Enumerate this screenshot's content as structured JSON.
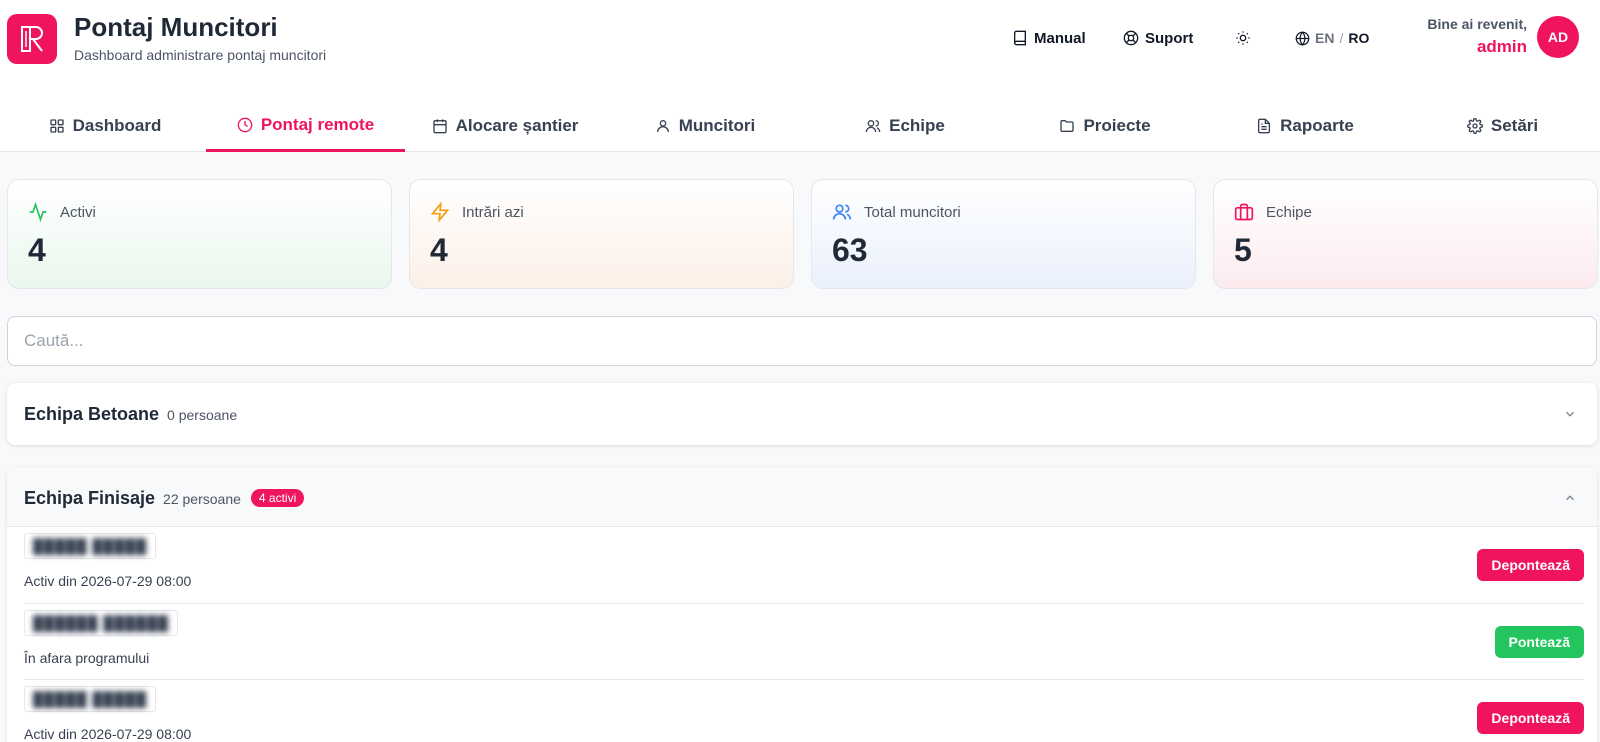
{
  "header": {
    "title": "Pontaj Muncitori",
    "subtitle": "Dashboard administrare pontaj muncitori",
    "manual_label": "Manual",
    "support_label": "Suport",
    "lang_en": "EN",
    "lang_sep": "/",
    "lang_ro": "RO",
    "welcome_text": "Bine ai revenit,",
    "username": "admin",
    "avatar_initials": "AD"
  },
  "tabs": [
    {
      "label": "Dashboard",
      "icon": "grid-icon",
      "active": false
    },
    {
      "label": "Pontaj remote",
      "icon": "clock-icon",
      "active": true
    },
    {
      "label": "Alocare șantier",
      "icon": "calendar-icon",
      "active": false
    },
    {
      "label": "Muncitori",
      "icon": "user-icon",
      "active": false
    },
    {
      "label": "Echipe",
      "icon": "users-icon",
      "active": false
    },
    {
      "label": "Proiecte",
      "icon": "folder-icon",
      "active": false
    },
    {
      "label": "Rapoarte",
      "icon": "file-text-icon",
      "active": false
    },
    {
      "label": "Setări",
      "icon": "gear-icon",
      "active": false
    }
  ],
  "stats": [
    {
      "label": "Activi",
      "value": "4",
      "icon": "activity-icon",
      "color": "#22c55e"
    },
    {
      "label": "Intrări azi",
      "value": "4",
      "icon": "lightning-icon",
      "color": "#f59e0b"
    },
    {
      "label": "Total muncitori",
      "value": "63",
      "icon": "users-icon",
      "color": "#3b82f6"
    },
    {
      "label": "Echipe",
      "value": "5",
      "icon": "briefcase-icon",
      "color": "#f0135f"
    }
  ],
  "search": {
    "placeholder": "Caută..."
  },
  "groups": [
    {
      "name": "Echipa Betoane",
      "count": "0 persoane",
      "expanded": false
    },
    {
      "name": "Echipa Finisaje",
      "count": "22 persoane",
      "badge": "4 activi",
      "expanded": true,
      "workers": [
        {
          "name": "█████ █████",
          "status": "Activ din 2026-07-29 08:00",
          "action": "Depontează"
        },
        {
          "name": "██████ ██████",
          "status": "În afara programului",
          "action": "Pontează"
        },
        {
          "name": "█████ █████",
          "status": "Activ din 2026-07-29 08:00",
          "action": "Depontează"
        }
      ]
    }
  ],
  "colors": {
    "accent": "#f0135f",
    "success": "#22c55e"
  }
}
